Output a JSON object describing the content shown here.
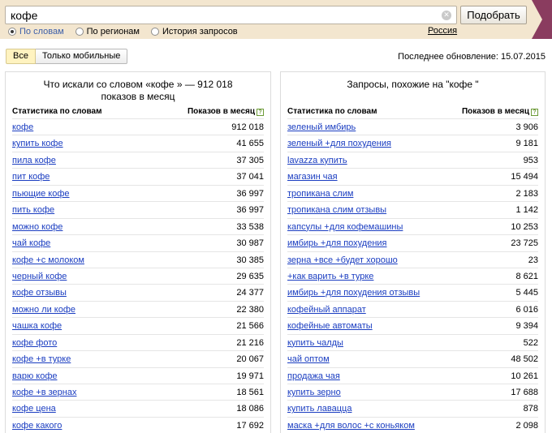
{
  "search": {
    "query": "кофе",
    "submit_label": "Подобрать",
    "modes": [
      {
        "label": "По словам",
        "checked": true
      },
      {
        "label": "По регионам",
        "checked": false
      },
      {
        "label": "История запросов",
        "checked": false
      }
    ],
    "region": "Россия"
  },
  "filters": {
    "all_label": "Все",
    "mobile_label": "Только мобильные",
    "updated_text": "Последнее обновление: 15.07.2015"
  },
  "colors": {
    "topbar": "#f3e6cf",
    "flag": "#8a3c5f",
    "link": "#1a3dc1",
    "active_filter": "#fff3c0"
  },
  "left_panel": {
    "title_line1": "Что искали со словом «кофе » — 912 018",
    "title_line2": "показов в месяц",
    "col_query": "Статистика по словам",
    "col_count": "Показов в месяц",
    "rows": [
      {
        "q": "кофе",
        "n": "912 018"
      },
      {
        "q": "купить кофе",
        "n": "41 655"
      },
      {
        "q": "пила кофе",
        "n": "37 305"
      },
      {
        "q": "пит кофе",
        "n": "37 041"
      },
      {
        "q": "пьющие кофе",
        "n": "36 997"
      },
      {
        "q": "пить кофе",
        "n": "36 997"
      },
      {
        "q": "можно кофе",
        "n": "33 538"
      },
      {
        "q": "чай кофе",
        "n": "30 987"
      },
      {
        "q": "кофе +с молоком",
        "n": "30 385"
      },
      {
        "q": "черный кофе",
        "n": "29 635"
      },
      {
        "q": "кофе отзывы",
        "n": "24 377"
      },
      {
        "q": "можно ли кофе",
        "n": "22 380"
      },
      {
        "q": "чашка кофе",
        "n": "21 566"
      },
      {
        "q": "кофе фото",
        "n": "21 216"
      },
      {
        "q": "кофе +в турке",
        "n": "20 067"
      },
      {
        "q": "варю кофе",
        "n": "19 971"
      },
      {
        "q": "кофе +в зернах",
        "n": "18 561"
      },
      {
        "q": "кофе цена",
        "n": "18 086"
      },
      {
        "q": "кофе какого",
        "n": "17 692"
      }
    ]
  },
  "right_panel": {
    "title": "Запросы, похожие на \"кофе \"",
    "col_query": "Статистика по словам",
    "col_count": "Показов в месяц",
    "rows": [
      {
        "q": "зеленый имбирь",
        "n": "3 906"
      },
      {
        "q": "зеленый +для похудения",
        "n": "9 181"
      },
      {
        "q": "lavazza купить",
        "n": "953"
      },
      {
        "q": "магазин чая",
        "n": "15 494"
      },
      {
        "q": "тропикана слим",
        "n": "2 183"
      },
      {
        "q": "тропикана слим отзывы",
        "n": "1 142"
      },
      {
        "q": "капсулы +для кофемашины",
        "n": "10 253"
      },
      {
        "q": "имбирь +для похудения",
        "n": "23 725"
      },
      {
        "q": "зерна +все +будет хорошо",
        "n": "23"
      },
      {
        "q": "+как варить +в турке",
        "n": "8 621"
      },
      {
        "q": "имбирь +для похудения отзывы",
        "n": "5 445"
      },
      {
        "q": "кофейный аппарат",
        "n": "6 016"
      },
      {
        "q": "кофейные автоматы",
        "n": "9 394"
      },
      {
        "q": "купить чалды",
        "n": "522"
      },
      {
        "q": "чай оптом",
        "n": "48 502"
      },
      {
        "q": "продажа чая",
        "n": "10 261"
      },
      {
        "q": "купить зерно",
        "n": "17 688"
      },
      {
        "q": "купить лавацца",
        "n": "878"
      },
      {
        "q": "маска +для волос +с коньяком",
        "n": "2 098"
      }
    ]
  }
}
